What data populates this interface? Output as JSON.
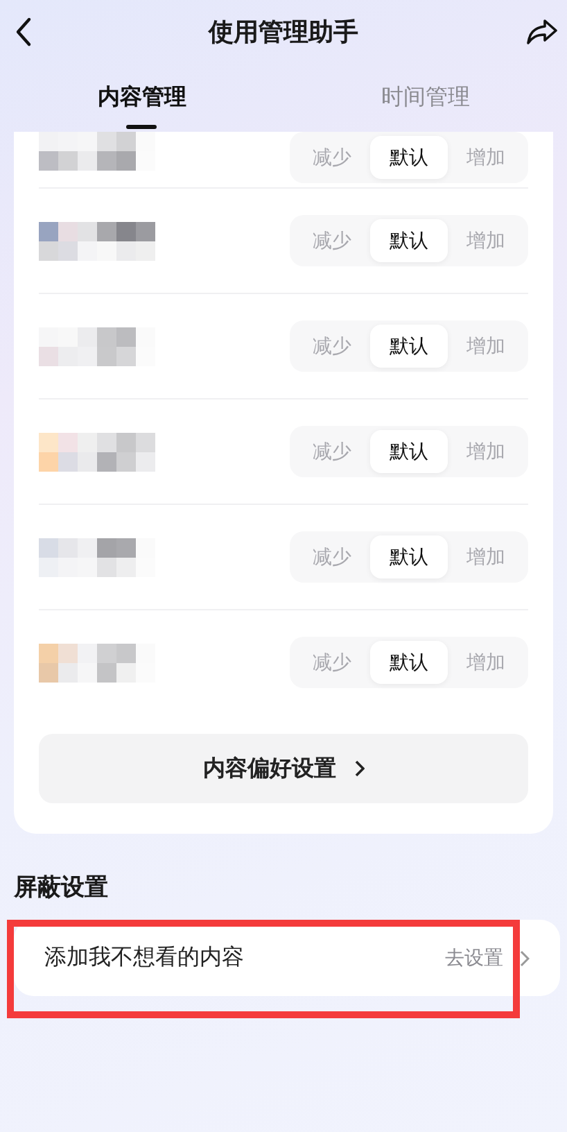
{
  "header": {
    "title": "使用管理助手"
  },
  "tabs": [
    {
      "label": "内容管理",
      "selected": true
    },
    {
      "label": "时间管理",
      "selected": false
    }
  ],
  "rows": [
    {
      "options": [
        {
          "label": "减少",
          "selected": false
        },
        {
          "label": "默认",
          "selected": true
        },
        {
          "label": "增加",
          "selected": false
        }
      ]
    },
    {
      "options": [
        {
          "label": "减少",
          "selected": false
        },
        {
          "label": "默认",
          "selected": true
        },
        {
          "label": "增加",
          "selected": false
        }
      ]
    },
    {
      "options": [
        {
          "label": "减少",
          "selected": false
        },
        {
          "label": "默认",
          "selected": true
        },
        {
          "label": "增加",
          "selected": false
        }
      ]
    },
    {
      "options": [
        {
          "label": "减少",
          "selected": false
        },
        {
          "label": "默认",
          "selected": true
        },
        {
          "label": "增加",
          "selected": false
        }
      ]
    },
    {
      "options": [
        {
          "label": "减少",
          "selected": false
        },
        {
          "label": "默认",
          "selected": true
        },
        {
          "label": "增加",
          "selected": false
        }
      ]
    },
    {
      "options": [
        {
          "label": "减少",
          "selected": false
        },
        {
          "label": "默认",
          "selected": true
        },
        {
          "label": "增加",
          "selected": false
        }
      ]
    }
  ],
  "preference_button": {
    "label": "内容偏好设置"
  },
  "block_section": {
    "title": "屏蔽设置",
    "item": {
      "label": "添加我不想看的内容",
      "action": "去设置",
      "highlighted": true
    }
  }
}
